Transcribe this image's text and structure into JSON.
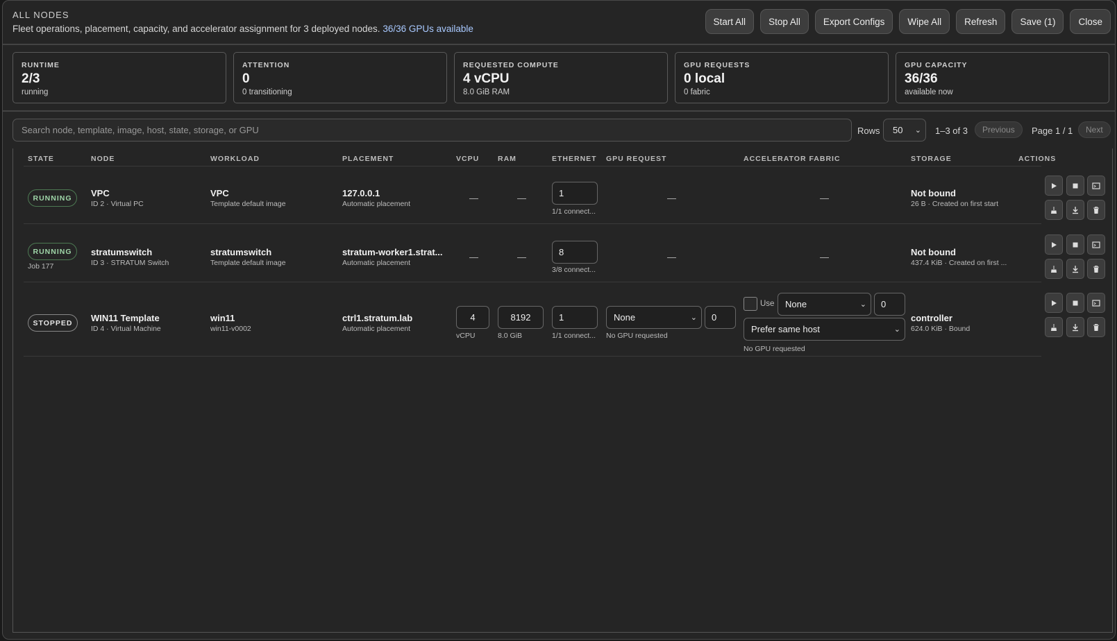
{
  "header": {
    "title": "ALL NODES",
    "subtitle": "Fleet operations, placement, capacity, and accelerator assignment for 3 deployed nodes.",
    "gpu_available": "36/36 GPUs available",
    "buttons": [
      "Start All",
      "Stop All",
      "Export Configs",
      "Wipe All",
      "Refresh",
      "Save (1)",
      "Close"
    ]
  },
  "stats": [
    {
      "label": "RUNTIME",
      "value": "2/3",
      "sub": "running"
    },
    {
      "label": "ATTENTION",
      "value": "0",
      "sub": "0 transitioning"
    },
    {
      "label": "REQUESTED COMPUTE",
      "value": "4 vCPU",
      "sub": "8.0 GiB RAM"
    },
    {
      "label": "GPU REQUESTS",
      "value": "0 local",
      "sub": "0 fabric"
    },
    {
      "label": "GPU CAPACITY",
      "value": "36/36",
      "sub": "available now"
    }
  ],
  "toolbar": {
    "search_placeholder": "Search node, template, image, host, state, storage, or GPU",
    "rows_label": "Rows",
    "rows_value": "50",
    "range": "1–3 of 3",
    "previous": "Previous",
    "page_info": "Page 1 / 1",
    "next": "Next"
  },
  "columns": [
    "STATE",
    "NODE",
    "WORKLOAD",
    "PLACEMENT",
    "VCPU",
    "RAM",
    "ETHERNET",
    "GPU REQUEST",
    "ACCELERATOR FABRIC",
    "STORAGE",
    "ACTIONS"
  ],
  "rows": [
    {
      "state": "RUNNING",
      "job": "",
      "node": "VPC",
      "node_sub": "ID 2 · Virtual PC",
      "workload": "VPC",
      "workload_sub": "Template default image",
      "placement": "127.0.0.1",
      "placement_sub": "Automatic placement",
      "vcpu": "—",
      "ram": "—",
      "ethernet": "1",
      "ethernet_sub": "1/1 connect...",
      "gpu_request": "—",
      "fabric": "—",
      "storage": "Not bound",
      "storage_sub": "26 B · Created on first start"
    },
    {
      "state": "RUNNING",
      "job": "Job 177",
      "node": "stratumswitch",
      "node_sub": "ID 3 · STRATUM Switch",
      "workload": "stratumswitch",
      "workload_sub": "Template default image",
      "placement": "stratum-worker1.strat...",
      "placement_sub": "Automatic placement",
      "vcpu": "—",
      "ram": "—",
      "ethernet": "8",
      "ethernet_sub": "3/8 connect...",
      "gpu_request": "—",
      "fabric": "—",
      "storage": "Not bound",
      "storage_sub": "437.4 KiB · Created on first ..."
    },
    {
      "state": "STOPPED",
      "job": "",
      "node": "WIN11 Template",
      "node_sub": "ID 4 · Virtual Machine",
      "workload": "win11",
      "workload_sub": "win11-v0002",
      "placement": "ctrl1.stratum.lab",
      "placement_sub": "Automatic placement",
      "vcpu": "4",
      "vcpu_sub": "vCPU",
      "ram": "8192",
      "ram_sub": "8.0 GiB",
      "ethernet": "1",
      "ethernet_sub": "1/1 connect...",
      "gpu_select": "None",
      "gpu_count": "0",
      "gpu_sub": "No GPU requested",
      "fabric_use": "Use",
      "fabric_select": "None",
      "fabric_count": "0",
      "fabric_policy": "Prefer same host",
      "fabric_sub": "No GPU requested",
      "storage": "controller",
      "storage_sub": "624.0 KiB · Bound"
    }
  ],
  "colors": {
    "accent_link": "#a9c9ff",
    "running": "#9fd6a8",
    "background": "#252525"
  }
}
